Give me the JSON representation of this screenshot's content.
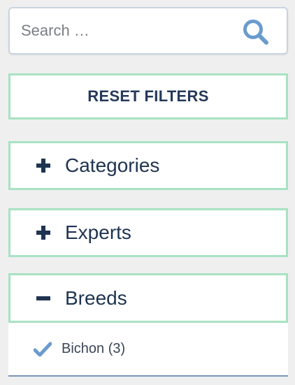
{
  "search": {
    "placeholder": "Search …",
    "icon": "search-icon"
  },
  "reset": {
    "label": "RESET FILTERS"
  },
  "filters": {
    "categories": {
      "label": "Categories",
      "state": "collapsed",
      "icon": "plus-icon"
    },
    "experts": {
      "label": "Experts",
      "state": "collapsed",
      "icon": "plus-icon"
    },
    "breeds": {
      "label": "Breeds",
      "state": "expanded",
      "icon": "minus-icon",
      "options": [
        {
          "label": "Bichon (3)",
          "checked": true
        }
      ]
    }
  },
  "colors": {
    "accent_border": "#a8e2c2",
    "search_icon": "#6a9bcf",
    "text_dark": "#1f3450",
    "background": "#efeff0"
  }
}
